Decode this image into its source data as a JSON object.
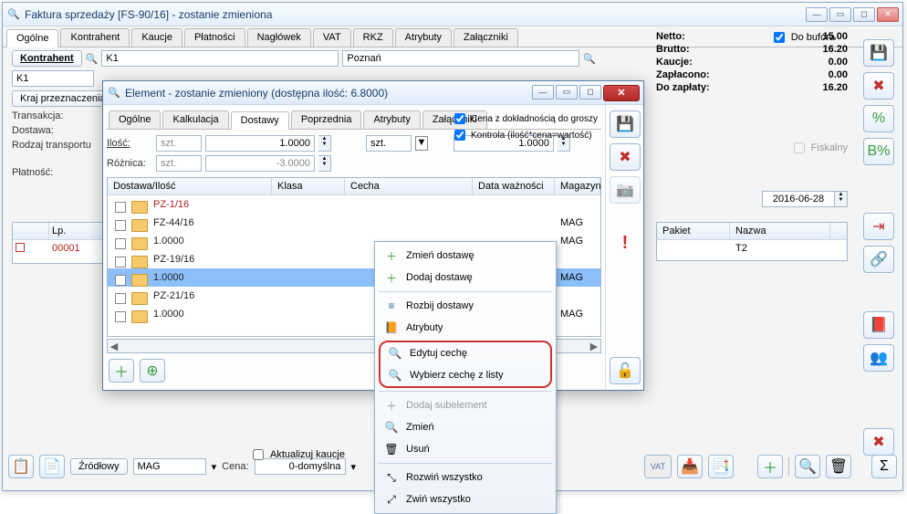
{
  "main_window": {
    "title": "Faktura sprzedaży [FS-90/16]  - zostanie zmieniona",
    "tabs": [
      "Ogólne",
      "Kontrahent",
      "Kaucje",
      "Płatności",
      "Nagłówek",
      "VAT",
      "RKZ",
      "Atrybuty",
      "Załączniki"
    ],
    "active_tab": 0,
    "do_bufora_label": "Do bufora",
    "do_bufora_checked": true,
    "kontrahent_label": "Kontrahent",
    "kontrahent_code": "K1",
    "kontrahent_city": "Poznań",
    "kontrahent_code2": "K1",
    "kraj_label": "Kraj przeznaczenia",
    "transakcja_label": "Transakcja:",
    "dostawa_label": "Dostawa:",
    "rodzaj_label": "Rodzaj transportu",
    "platnosc_label": "Płatność:",
    "fiskalny_label": "Fiskalny",
    "date_value": "2016-06-28",
    "grid_columns": [
      "Lp.",
      "",
      "",
      "Pakiet",
      "Nazwa"
    ],
    "grid_row_lp": "00001",
    "grid_row_name": "T2",
    "bottom": {
      "zrodlowy_label": "Źródłowy",
      "mag_value": "MAG",
      "cena_label": "Cena:",
      "cena_value": "0-domyślna",
      "aktualizuj_label": "Aktualizuj kaucje"
    }
  },
  "totals": {
    "netto_label": "Netto:",
    "netto": "15.00",
    "brutto_label": "Brutto:",
    "brutto": "16.20",
    "kaucje_label": "Kaucje:",
    "kaucje": "0.00",
    "zaplacono_label": "Zapłacono:",
    "zaplacono": "0.00",
    "do_zaplaty_label": "Do zapłaty:",
    "do_zaplaty": "16.20"
  },
  "dialog": {
    "title": "Element - zostanie zmieniony (dostępna ilość: 6.8000)",
    "tabs": [
      "Ogólne",
      "Kalkulacja",
      "Dostawy",
      "Poprzednia",
      "Atrybuty",
      "Załączniki"
    ],
    "active_tab": 2,
    "chk1_label": "Cena z dokładnością do groszy",
    "chk2_label": "Kontrola (ilość*cena=wartość)",
    "ilosc_label": "Ilość:",
    "roznica_label": "Różnica:",
    "unit": "szt.",
    "ilosc_val": "1.0000",
    "roznica_val": "-3.0000",
    "extra_unit": "szt.",
    "extra_val": "1.0000",
    "tree_columns": [
      "Dostawa/Ilość",
      "Klasa",
      "Cecha",
      "Data ważności",
      "Magazyn"
    ],
    "tree_rows": [
      {
        "code": "PZ-1/16",
        "red": true,
        "mag": ""
      },
      {
        "code": "FZ-44/16",
        "red": false,
        "mag": "MAG"
      },
      {
        "code": "1.0000",
        "red": false,
        "mag": "MAG"
      },
      {
        "code": "PZ-19/16",
        "red": false,
        "mag": ""
      },
      {
        "code": "1.0000",
        "red": false,
        "mag": "MAG",
        "sel": true
      },
      {
        "code": "PZ-21/16",
        "red": false,
        "mag": ""
      },
      {
        "code": "1.0000",
        "red": false,
        "mag": "MAG"
      }
    ]
  },
  "context_menu": {
    "zmien_dostawe": "Zmień dostawę",
    "dodaj_dostawe": "Dodaj dostawę",
    "rozbij_dostawy": "Rozbij dostawy",
    "atrybuty": "Atrybuty",
    "edytuj_ceche": "Edytuj cechę",
    "wybierz_ceche": "Wybierz cechę z listy",
    "dodaj_sub": "Dodaj subelement",
    "zmien": "Zmień",
    "usun": "Usuń",
    "rozwin": "Rozwiń wszystko",
    "zwin": "Zwiń wszystko"
  },
  "icons": {
    "save": "💾",
    "delete": "✖",
    "calc": "%",
    "bx": "B%",
    "export": "⇥",
    "link": "🔗",
    "book": "📕",
    "people": "👥",
    "cancel": "✖",
    "add": "＋",
    "search": "🔍",
    "trash": "🗑",
    "lock": "🔓",
    "warn": "!"
  }
}
